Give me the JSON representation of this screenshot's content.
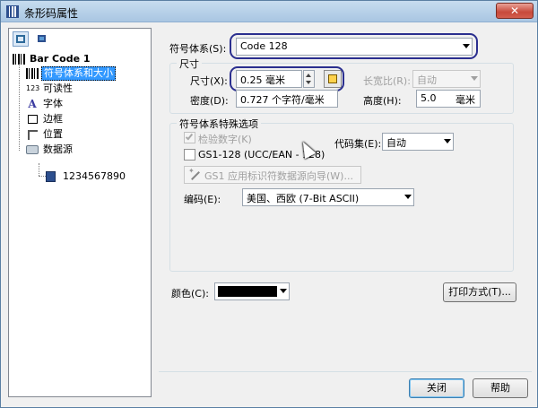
{
  "window": {
    "title": "条形码属性",
    "close_glyph": "✕"
  },
  "tree": {
    "root": "Bar Code 1",
    "items": [
      {
        "label": "符号体系和大小",
        "icon": "barcode-symbology-icon",
        "selected": true
      },
      {
        "label": "可读性",
        "icon": "readable-123-icon",
        "icon_text": "123"
      },
      {
        "label": "字体",
        "icon": "font-icon",
        "icon_text": "A"
      },
      {
        "label": "边框",
        "icon": "border-icon"
      },
      {
        "label": "位置",
        "icon": "position-icon"
      },
      {
        "label": "数据源",
        "icon": "data-source-icon"
      },
      {
        "label": "1234567890",
        "icon": "data-value-icon"
      }
    ]
  },
  "symbology": {
    "label": "符号体系(S):",
    "value": "Code 128"
  },
  "size_group": {
    "title": "尺寸",
    "size_label": "尺寸(X):",
    "size_value": "0.25 毫米",
    "ratio_label": "长宽比(R):",
    "ratio_value": "自动",
    "density_label": "密度(D):",
    "density_value": "0.727 个字符/毫米",
    "height_label": "高度(H):",
    "height_value": "5.0",
    "height_unit": "毫米"
  },
  "options_group": {
    "title": "符号体系特殊选项",
    "check_digit_label": "检验数字(K)",
    "check_digit_checked": true,
    "gs1_label": "GS1-128 (UCC/EAN - 128)",
    "gs1_checked": false,
    "wizard_label": "GS1 应用标识符数据源向导(W)...",
    "codeset_label": "代码集(E):",
    "codeset_value": "自动",
    "encoding_label": "编码(E):",
    "encoding_value": "美国、西欧 (7-Bit ASCII)"
  },
  "color": {
    "label": "颜色(C):",
    "value": "#000000"
  },
  "buttons": {
    "print_method": "打印方式(T)...",
    "close": "关闭",
    "help": "帮助"
  },
  "colors": {
    "highlight": "#2b2f8f",
    "selected": "#3399ff"
  }
}
